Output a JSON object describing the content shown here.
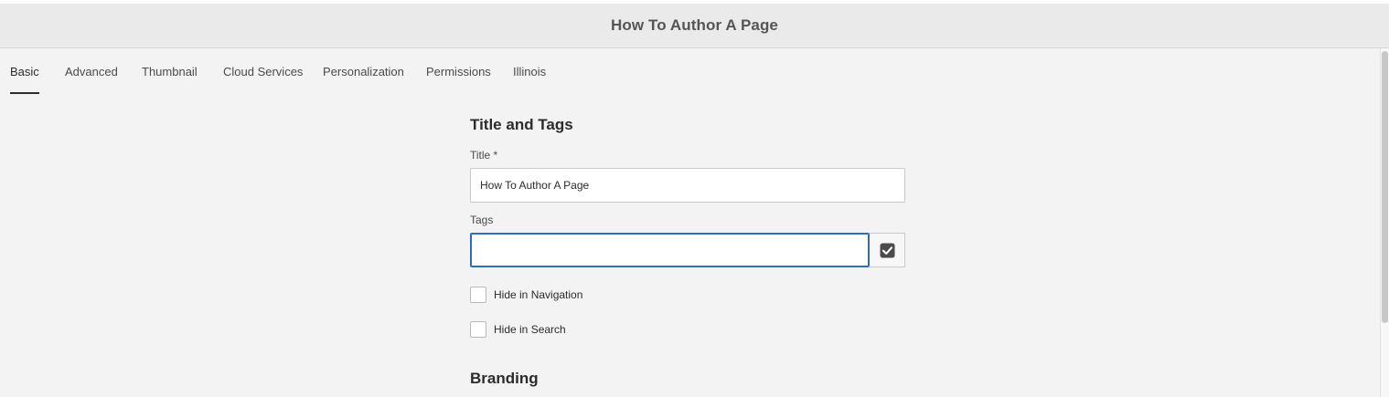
{
  "header": {
    "title": "How To Author A Page"
  },
  "tabs": [
    {
      "label": "Basic",
      "active": true
    },
    {
      "label": "Advanced",
      "active": false
    },
    {
      "label": "Thumbnail",
      "active": false
    },
    {
      "label": "Cloud Services",
      "active": false
    },
    {
      "label": "Personalization",
      "active": false
    },
    {
      "label": "Permissions",
      "active": false
    },
    {
      "label": "Illinois",
      "active": false
    }
  ],
  "title_tags": {
    "heading": "Title and Tags",
    "title_label": "Title *",
    "title_value": "How To Author A Page",
    "tags_label": "Tags",
    "tags_value": "",
    "tags_picker_icon": "check-square-icon"
  },
  "checkboxes": [
    {
      "label": "Hide in Navigation",
      "checked": false
    },
    {
      "label": "Hide in Search",
      "checked": false
    }
  ],
  "branding": {
    "heading": "Branding"
  },
  "colors": {
    "focus_border": "#2d6cc0",
    "active_tab_underline": "#2c2c2c",
    "header_bg": "#eaeaea",
    "page_bg": "#f3f3f3"
  }
}
